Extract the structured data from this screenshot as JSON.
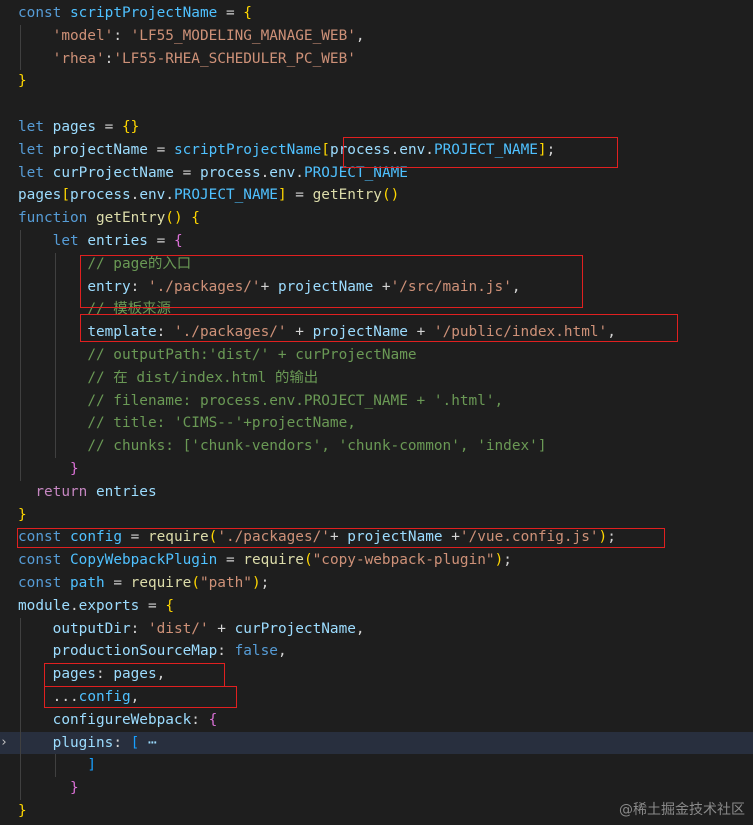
{
  "editor": {
    "lines": [
      [
        [
          "kw",
          "const"
        ],
        [
          "pun",
          " "
        ],
        [
          "const",
          "scriptProjectName"
        ],
        [
          "pun",
          " = "
        ],
        [
          "b1",
          "{"
        ]
      ],
      [
        [
          "pun",
          "    "
        ],
        [
          "str",
          "'model'"
        ],
        [
          "pun",
          ": "
        ],
        [
          "str",
          "'LF55_MODELING_MANAGE_WEB'"
        ],
        [
          "pun",
          ","
        ]
      ],
      [
        [
          "pun",
          "    "
        ],
        [
          "str",
          "'rhea'"
        ],
        [
          "pun",
          ":"
        ],
        [
          "str",
          "'LF55-RHEA_SCHEDULER_PC_WEB'"
        ]
      ],
      [
        [
          "b1",
          "}"
        ]
      ],
      [],
      [
        [
          "kw",
          "let"
        ],
        [
          "pun",
          " "
        ],
        [
          "var",
          "pages"
        ],
        [
          "pun",
          " = "
        ],
        [
          "b1",
          "{}"
        ]
      ],
      [
        [
          "kw",
          "let"
        ],
        [
          "pun",
          " "
        ],
        [
          "var",
          "projectName"
        ],
        [
          "pun",
          " = "
        ],
        [
          "const",
          "scriptProjectName"
        ],
        [
          "b1",
          "["
        ],
        [
          "var",
          "process"
        ],
        [
          "pun",
          "."
        ],
        [
          "var",
          "env"
        ],
        [
          "pun",
          "."
        ],
        [
          "const",
          "PROJECT_NAME"
        ],
        [
          "b1",
          "]"
        ],
        [
          "pun",
          ";"
        ]
      ],
      [
        [
          "kw",
          "let"
        ],
        [
          "pun",
          " "
        ],
        [
          "var",
          "curProjectName"
        ],
        [
          "pun",
          " = "
        ],
        [
          "var",
          "process"
        ],
        [
          "pun",
          "."
        ],
        [
          "var",
          "env"
        ],
        [
          "pun",
          "."
        ],
        [
          "const",
          "PROJECT_NAME"
        ]
      ],
      [
        [
          "var",
          "pages"
        ],
        [
          "b1",
          "["
        ],
        [
          "var",
          "process"
        ],
        [
          "pun",
          "."
        ],
        [
          "var",
          "env"
        ],
        [
          "pun",
          "."
        ],
        [
          "const",
          "PROJECT_NAME"
        ],
        [
          "b1",
          "]"
        ],
        [
          "pun",
          " = "
        ],
        [
          "fn",
          "getEntry"
        ],
        [
          "b1",
          "()"
        ]
      ],
      [
        [
          "kw",
          "function"
        ],
        [
          "pun",
          " "
        ],
        [
          "fn",
          "getEntry"
        ],
        [
          "b1",
          "()"
        ],
        [
          "pun",
          " "
        ],
        [
          "b1",
          "{"
        ]
      ],
      [
        [
          "pun",
          "    "
        ],
        [
          "kw",
          "let"
        ],
        [
          "pun",
          " "
        ],
        [
          "var",
          "entries"
        ],
        [
          "pun",
          " = "
        ],
        [
          "b2",
          "{"
        ]
      ],
      [
        [
          "pun",
          "        "
        ],
        [
          "cm",
          "// page的入口"
        ]
      ],
      [
        [
          "pun",
          "        "
        ],
        [
          "var",
          "entry"
        ],
        [
          "pun",
          ": "
        ],
        [
          "str",
          "'./packages/'"
        ],
        [
          "pun",
          "+ "
        ],
        [
          "var",
          "projectName"
        ],
        [
          "pun",
          " +"
        ],
        [
          "str",
          "'/src/main.js'"
        ],
        [
          "pun",
          ","
        ]
      ],
      [
        [
          "pun",
          "        "
        ],
        [
          "cm",
          "// 模板来源"
        ]
      ],
      [
        [
          "pun",
          "        "
        ],
        [
          "var",
          "template"
        ],
        [
          "pun",
          ": "
        ],
        [
          "str",
          "'./packages/'"
        ],
        [
          "pun",
          " + "
        ],
        [
          "var",
          "projectName"
        ],
        [
          "pun",
          " + "
        ],
        [
          "str",
          "'/public/index.html'"
        ],
        [
          "pun",
          ","
        ]
      ],
      [
        [
          "pun",
          "        "
        ],
        [
          "cm",
          "// outputPath:'dist/' + curProjectName"
        ]
      ],
      [
        [
          "pun",
          "        "
        ],
        [
          "cm",
          "// 在 dist/index.html 的输出"
        ]
      ],
      [
        [
          "pun",
          "        "
        ],
        [
          "cm",
          "// filename: process.env.PROJECT_NAME + '.html',"
        ]
      ],
      [
        [
          "pun",
          "        "
        ],
        [
          "cm",
          "// title: 'CIMS--'+projectName,"
        ]
      ],
      [
        [
          "pun",
          "        "
        ],
        [
          "cm",
          "// chunks: ['chunk-vendors', 'chunk-common', 'index']"
        ]
      ],
      [
        [
          "pun",
          "      "
        ],
        [
          "b2",
          "}"
        ]
      ],
      [
        [
          "pun",
          "  "
        ],
        [
          "ctrl",
          "return"
        ],
        [
          "pun",
          " "
        ],
        [
          "var",
          "entries"
        ]
      ],
      [
        [
          "b1",
          "}"
        ]
      ],
      [
        [
          "kw",
          "const"
        ],
        [
          "pun",
          " "
        ],
        [
          "const",
          "config"
        ],
        [
          "pun",
          " = "
        ],
        [
          "fn",
          "require"
        ],
        [
          "b1",
          "("
        ],
        [
          "str",
          "'./packages/'"
        ],
        [
          "pun",
          "+ "
        ],
        [
          "var",
          "projectName"
        ],
        [
          "pun",
          " +"
        ],
        [
          "str",
          "'/vue.config.js'"
        ],
        [
          "b1",
          ")"
        ],
        [
          "pun",
          ";"
        ]
      ],
      [
        [
          "kw",
          "const"
        ],
        [
          "pun",
          " "
        ],
        [
          "const",
          "CopyWebpackPlugin"
        ],
        [
          "pun",
          " = "
        ],
        [
          "fn",
          "require"
        ],
        [
          "b1",
          "("
        ],
        [
          "str",
          "\"copy-webpack-plugin\""
        ],
        [
          "b1",
          ")"
        ],
        [
          "pun",
          ";"
        ]
      ],
      [
        [
          "kw",
          "const"
        ],
        [
          "pun",
          " "
        ],
        [
          "const",
          "path"
        ],
        [
          "pun",
          " = "
        ],
        [
          "fn",
          "require"
        ],
        [
          "b1",
          "("
        ],
        [
          "str",
          "\"path\""
        ],
        [
          "b1",
          ")"
        ],
        [
          "pun",
          ";"
        ]
      ],
      [
        [
          "var",
          "module"
        ],
        [
          "pun",
          "."
        ],
        [
          "var",
          "exports"
        ],
        [
          "pun",
          " = "
        ],
        [
          "b1",
          "{"
        ]
      ],
      [
        [
          "pun",
          "    "
        ],
        [
          "var",
          "outputDir"
        ],
        [
          "pun",
          ": "
        ],
        [
          "str",
          "'dist/'"
        ],
        [
          "pun",
          " + "
        ],
        [
          "var",
          "curProjectName"
        ],
        [
          "pun",
          ","
        ]
      ],
      [
        [
          "pun",
          "    "
        ],
        [
          "var",
          "productionSourceMap"
        ],
        [
          "pun",
          ": "
        ],
        [
          "kw",
          "false"
        ],
        [
          "pun",
          ","
        ]
      ],
      [
        [
          "pun",
          "    "
        ],
        [
          "var",
          "pages"
        ],
        [
          "pun",
          ": "
        ],
        [
          "var",
          "pages"
        ],
        [
          "pun",
          ","
        ]
      ],
      [
        [
          "pun",
          "    ..."
        ],
        [
          "const",
          "config"
        ],
        [
          "pun",
          ","
        ]
      ],
      [
        [
          "pun",
          "    "
        ],
        [
          "var",
          "configureWebpack"
        ],
        [
          "pun",
          ": "
        ],
        [
          "b2",
          "{"
        ]
      ],
      [
        [
          "pun",
          "    "
        ],
        [
          "var",
          "plugins"
        ],
        [
          "pun",
          ": "
        ],
        [
          "b3",
          "["
        ],
        [
          "fold",
          " ⋯"
        ]
      ],
      [
        [
          "pun",
          "        "
        ],
        [
          "b3",
          "]"
        ]
      ],
      [
        [
          "pun",
          "      "
        ],
        [
          "b2",
          "}"
        ]
      ],
      [
        [
          "b1",
          "}"
        ]
      ]
    ],
    "current_line": 32,
    "fold_marker": "›",
    "accent_colors": {
      "keyword": "#569cd6",
      "string": "#ce9178",
      "comment": "#6a9955",
      "highlight_box": "#e02020"
    }
  },
  "watermark": "@稀土掘金技术社区"
}
